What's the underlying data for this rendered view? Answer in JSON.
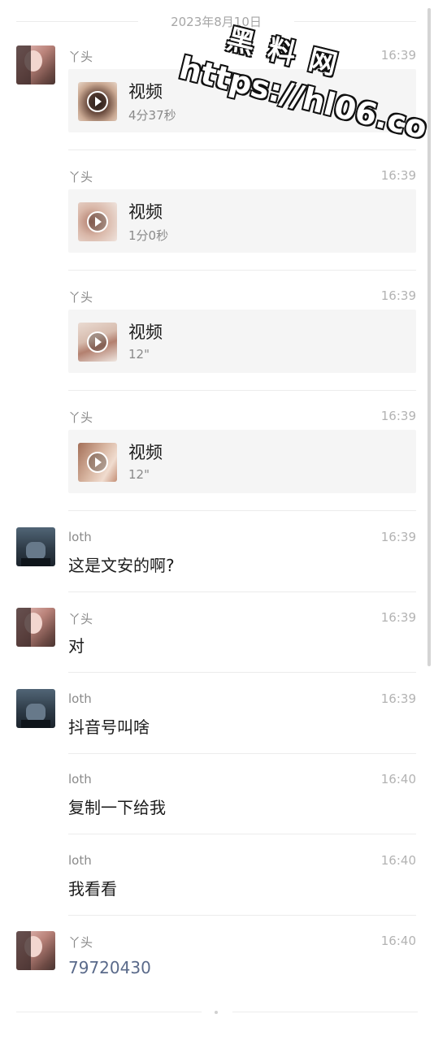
{
  "date_separator": "2023年8月10日",
  "watermark": {
    "line1": "黑料网",
    "line2": "https://hl06.co"
  },
  "messages": [
    {
      "sender": "丫头",
      "time": "16:39",
      "type": "video",
      "card_title": "视频",
      "duration": "4分37秒"
    },
    {
      "sender": "丫头",
      "time": "16:39",
      "type": "video",
      "card_title": "视频",
      "duration": "1分0秒"
    },
    {
      "sender": "丫头",
      "time": "16:39",
      "type": "video",
      "card_title": "视频",
      "duration": "12\""
    },
    {
      "sender": "丫头",
      "time": "16:39",
      "type": "video",
      "card_title": "视频",
      "duration": "12\""
    },
    {
      "sender": "loth",
      "time": "16:39",
      "type": "text",
      "text": "这是文安的啊?"
    },
    {
      "sender": "丫头",
      "time": "16:39",
      "type": "text",
      "text": "对"
    },
    {
      "sender": "loth",
      "time": "16:39",
      "type": "text",
      "text": "抖音号叫啥"
    },
    {
      "sender": "loth",
      "time": "16:40",
      "type": "text",
      "text": "复制一下给我"
    },
    {
      "sender": "loth",
      "time": "16:40",
      "type": "text",
      "text": "我看看"
    },
    {
      "sender": "丫头",
      "time": "16:40",
      "type": "text",
      "text": "79720430"
    }
  ]
}
